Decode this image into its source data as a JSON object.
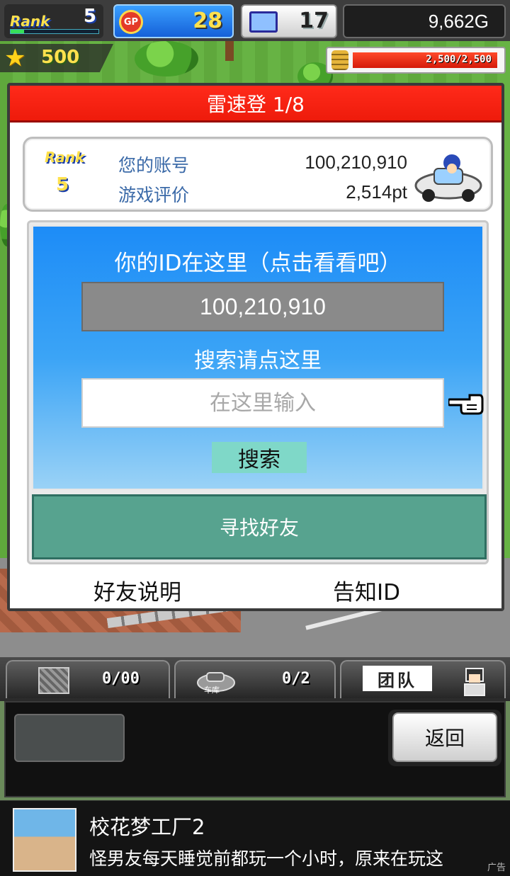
{
  "hud": {
    "rank_label": "Rank",
    "rank_value": "5",
    "rank_progress": 0.15,
    "gp_icon_text": "GP",
    "gp_value": "28",
    "pc_value": "17",
    "gold_value": "9,662G",
    "star_value": "500",
    "fuel_value": "2,500/2,500",
    "fuel_fraction": 1.0
  },
  "dialog": {
    "title": "雷速登 1/8",
    "account": {
      "rank_label": "Rank",
      "rank_value": "5",
      "id_label": "您的账号",
      "id_value": "100,210,910",
      "rating_label": "游戏评价",
      "rating_value": "2,514pt"
    },
    "id_heading": "你的ID在这里（点击看看吧）",
    "id_box_value": "100,210,910",
    "search_heading": "搜索请点这里",
    "search_placeholder": "在这里输入",
    "search_value": "",
    "search_button": "搜索",
    "find_friends_button": "寻找好友",
    "friends_help_link": "好友说明",
    "share_id_link": "告知ID"
  },
  "tabs": {
    "items_count": "0/00",
    "garage_label": "车库",
    "garage_count": "0/2",
    "team_label": "团队"
  },
  "bottom": {
    "back_button": "返回"
  },
  "ad": {
    "title": "校花梦工厂2",
    "text": "怪男友每天睡觉前都玩一个小时，原来在玩这",
    "tag": "广告"
  },
  "colors": {
    "title_bar": "#ff2a1a",
    "panel_blue": "#1d8cf7",
    "find_friends": "#57a38f",
    "search_button": "#7fd8c8",
    "label_blue": "#3b6aa8"
  }
}
